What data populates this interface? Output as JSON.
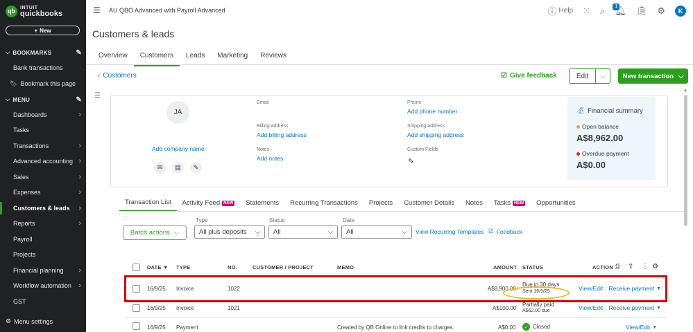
{
  "brand": {
    "line1": "INTUIT",
    "line2": "quickbooks",
    "badge": "qb"
  },
  "sidebar": {
    "new_label": "New",
    "bookmarks_header": "BOOKMARKS",
    "bookmarks": [
      {
        "label": "Bank transactions"
      },
      {
        "label": "Bookmark this page"
      }
    ],
    "menu_header": "MENU",
    "menu": [
      {
        "label": "Dashboards",
        "chevron": "›"
      },
      {
        "label": "Tasks",
        "chevron": ""
      },
      {
        "label": "Transactions",
        "chevron": "›"
      },
      {
        "label": "Advanced accounting",
        "chevron": "›"
      },
      {
        "label": "Sales",
        "chevron": "›"
      },
      {
        "label": "Expenses",
        "chevron": "›"
      },
      {
        "label": "Customers & leads",
        "chevron": "›"
      },
      {
        "label": "Reports",
        "chevron": "›"
      },
      {
        "label": "Payroll",
        "chevron": ""
      },
      {
        "label": "Projects",
        "chevron": ""
      },
      {
        "label": "Financial planning",
        "chevron": "›"
      },
      {
        "label": "Workflow automation",
        "chevron": "›"
      },
      {
        "label": "GST",
        "chevron": ""
      }
    ],
    "footer": "Menu settings"
  },
  "topbar": {
    "company": "AU QBO Advanced with Payroll Advanced",
    "help": "Help",
    "notif_count": "1",
    "avatar": "K"
  },
  "page": {
    "title": "Customers & leads",
    "tabs": [
      "Overview",
      "Customers",
      "Leads",
      "Marketing",
      "Reviews"
    ],
    "back": "Customers",
    "give_feedback": "Give feedback",
    "edit": "Edit",
    "new_transaction": "New transaction"
  },
  "customer": {
    "initials": "JA",
    "add_company": "Add company name",
    "email_label": "Email",
    "billing_label": "Billing address",
    "billing_link": "Add billing address",
    "notes_label": "Notes",
    "notes_link": "Add notes",
    "phone_label": "Phone",
    "phone_link": "Add phone number",
    "shipping_label": "Shipping address",
    "shipping_link": "Add shipping address",
    "custom_label": "Custom Fields"
  },
  "financial": {
    "title": "Financial summary",
    "open_label": "Open balance",
    "open_value": "A$8,962.00",
    "overdue_label": "Overdue payment",
    "overdue_value": "A$0.00",
    "open_color": "#f2a71b",
    "overdue_color": "#d52b1e"
  },
  "subtabs": [
    {
      "label": "Transaction List",
      "badge": ""
    },
    {
      "label": "Activity Feed",
      "badge": "NEW"
    },
    {
      "label": "Statements",
      "badge": ""
    },
    {
      "label": "Recurring Transactions",
      "badge": ""
    },
    {
      "label": "Projects",
      "badge": ""
    },
    {
      "label": "Customer Details",
      "badge": ""
    },
    {
      "label": "Notes",
      "badge": ""
    },
    {
      "label": "Tasks",
      "badge": "NEW"
    },
    {
      "label": "Opportunities",
      "badge": ""
    }
  ],
  "filters": {
    "batch": "Batch actions",
    "type_label": "Type",
    "type_value": "All plus deposits",
    "status_label": "Status",
    "status_value": "All",
    "date_label": "Date",
    "date_value": "All",
    "recurring_link": "View Recurring Templates",
    "feedback_link": "Feedback"
  },
  "table": {
    "headers": {
      "date": "DATE ▼",
      "type": "TYPE",
      "no": "NO.",
      "customer": "CUSTOMER / PROJECT",
      "memo": "MEMO",
      "amount": "AMOUNT",
      "status": "STATUS",
      "action": "ACTION"
    },
    "rows": [
      {
        "date": "16/9/25",
        "type": "Invoice",
        "no": "1022",
        "memo": "",
        "amount": "A$8,900.00",
        "status1": "Due in 30 days",
        "status2": "Sent 16/9/25",
        "act1": "View/Edit",
        "act2": "Receive payment"
      },
      {
        "date": "16/9/25",
        "type": "Invoice",
        "no": "1021",
        "memo": "",
        "amount": "A$100.00",
        "status1": "Partially paid",
        "status2": "A$62.00 due",
        "act1": "View/Edit",
        "act2": "Receive payment"
      },
      {
        "date": "16/9/25",
        "type": "Payment",
        "no": "",
        "memo": "Created by QB Online to link credits to charges",
        "amount": "A$0.00",
        "status1": "Closed",
        "status2": "",
        "act1": "View/Edit",
        "act2": ""
      }
    ]
  },
  "colors": {
    "brand_green": "#2ca01c",
    "link_blue": "#0077c5",
    "sidebar_bg": "#202123",
    "highlight_red": "#e0000c",
    "oval_yellow": "#f2b81c"
  }
}
